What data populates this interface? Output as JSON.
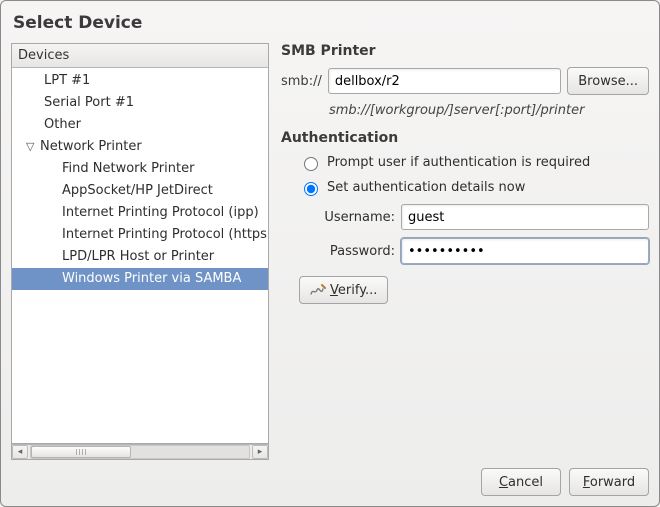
{
  "title": "Select Device",
  "tree": {
    "header": "Devices",
    "items": {
      "lpt": "LPT #1",
      "serial": "Serial Port #1",
      "other": "Other",
      "network": "Network Printer",
      "find": "Find Network Printer",
      "appsocket": "AppSocket/HP JetDirect",
      "ipp": "Internet Printing Protocol (ipp)",
      "ipps": "Internet Printing Protocol (https)",
      "lpd": "LPD/LPR Host or Printer",
      "samba": "Windows Printer via SAMBA"
    }
  },
  "smb": {
    "section_title": "SMB Printer",
    "scheme_label": "smb://",
    "uri_value": "dellbox/r2",
    "browse_label": "Browse...",
    "hint": "smb://[workgroup/]server[:port]/printer"
  },
  "auth": {
    "section_title": "Authentication",
    "radio_prompt": "Prompt user if authentication is required",
    "radio_set_now": "Set authentication details now",
    "username_label": "Username:",
    "username_value": "guest",
    "password_label": "Password:",
    "password_value": "••••••••••",
    "verify_label": "Verify..."
  },
  "footer": {
    "cancel": "Cancel",
    "forward": "Forward"
  }
}
